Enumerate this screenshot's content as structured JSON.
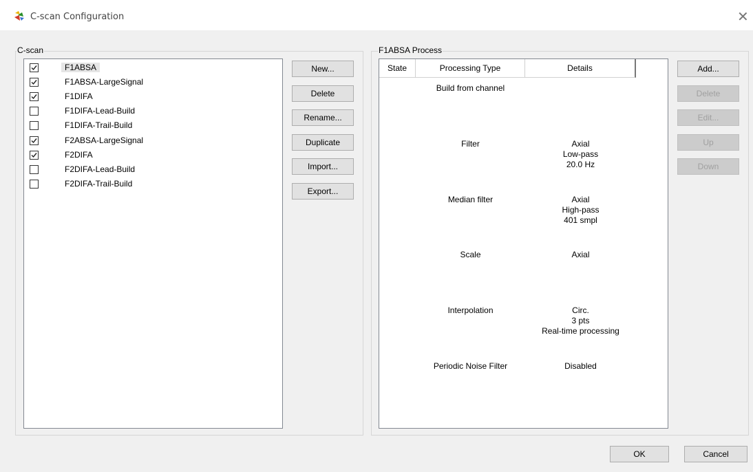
{
  "window": {
    "title": "C-scan Configuration"
  },
  "cscan": {
    "group_label": "C-scan",
    "items": [
      {
        "label": "F1ABSA",
        "checked": true,
        "selected": true
      },
      {
        "label": "F1ABSA-LargeSignal",
        "checked": true,
        "selected": false
      },
      {
        "label": "F1DIFA",
        "checked": true,
        "selected": false
      },
      {
        "label": "F1DIFA-Lead-Build",
        "checked": false,
        "selected": false
      },
      {
        "label": "F1DIFA-Trail-Build",
        "checked": false,
        "selected": false
      },
      {
        "label": "F2ABSA-LargeSignal",
        "checked": true,
        "selected": false
      },
      {
        "label": "F2DIFA",
        "checked": true,
        "selected": false
      },
      {
        "label": "F2DIFA-Lead-Build",
        "checked": false,
        "selected": false
      },
      {
        "label": "F2DIFA-Trail-Build",
        "checked": false,
        "selected": false
      }
    ],
    "buttons": {
      "new": "New...",
      "delete": "Delete",
      "rename": "Rename...",
      "duplicate": "Duplicate",
      "import": "Import...",
      "export": "Export..."
    }
  },
  "process": {
    "group_label": "F1ABSA Process",
    "columns": {
      "state": "State",
      "type": "Processing Type",
      "details": "Details"
    },
    "rows": [
      {
        "type": "Build from channel",
        "details": []
      },
      {
        "type": "Filter",
        "details": [
          "Axial",
          "Low-pass",
          "20.0 Hz"
        ]
      },
      {
        "type": "Median filter",
        "details": [
          "Axial",
          "High-pass",
          "401 smpl"
        ]
      },
      {
        "type": "Scale",
        "details": [
          "Axial"
        ]
      },
      {
        "type": "Interpolation",
        "details": [
          "Circ.",
          "3 pts",
          "Real-time processing"
        ]
      },
      {
        "type": "Periodic Noise Filter",
        "details": [
          "Disabled"
        ]
      }
    ],
    "buttons": {
      "add": "Add...",
      "delete": "Delete",
      "edit": "Edit...",
      "up": "Up",
      "down": "Down"
    }
  },
  "footer": {
    "ok": "OK",
    "cancel": "Cancel"
  }
}
